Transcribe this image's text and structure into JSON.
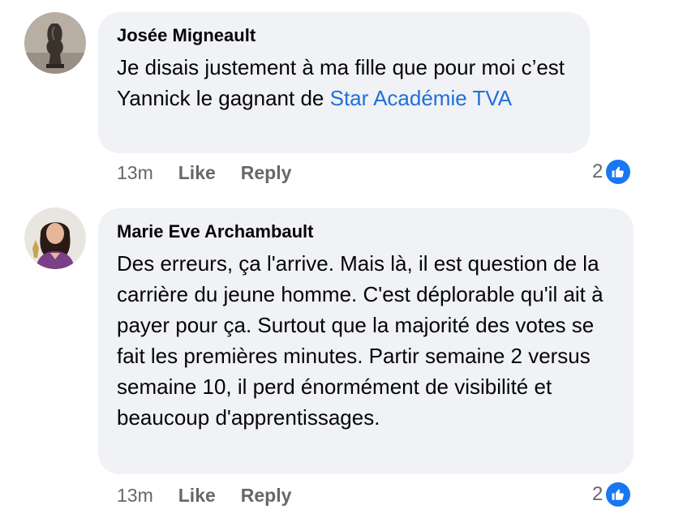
{
  "comments": [
    {
      "author": "Josée Migneault",
      "text_before_link": "Je disais justement à ma fille que pour moi c’est Yannick le gagnant de ",
      "link": "Star Académie TVA",
      "time": "13m",
      "like_label": "Like",
      "reply_label": "Reply",
      "reaction_count": "2",
      "reaction_icon": "thumbs-up-icon"
    },
    {
      "author": "Marie Eve Archambault",
      "text": "Des erreurs, ça l'arrive. Mais là, il est question de la carrière du jeune homme. C'est déplorable qu'il ait à payer pour ça. Surtout que la majorité des votes se fait les premières minutes. Partir semaine 2 versus semaine 10, il perd énormément de visibilité et beaucoup d'apprentissages.",
      "time": "13m",
      "like_label": "Like",
      "reply_label": "Reply",
      "reaction_count": "2",
      "reaction_icon": "thumbs-up-icon"
    }
  ],
  "colors": {
    "bubble": "#f0f2f5",
    "link": "#216fdb",
    "meta": "#65676b",
    "like_badge": "#1877f2"
  }
}
